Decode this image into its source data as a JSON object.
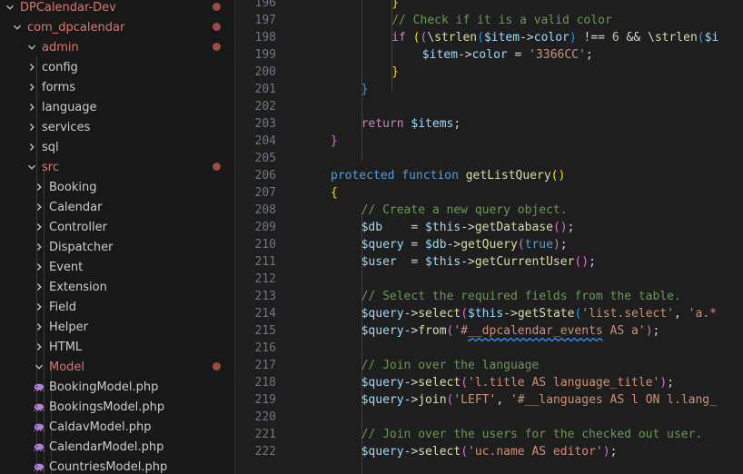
{
  "sidebar": {
    "items": [
      {
        "label": "DPCalendar-Dev",
        "depth": 0,
        "expanded": true,
        "type": "folder",
        "modified": true
      },
      {
        "label": "com_dpcalendar",
        "depth": 1,
        "expanded": true,
        "type": "folder",
        "modified": true
      },
      {
        "label": "admin",
        "depth": 2,
        "expanded": true,
        "type": "folder",
        "modified": true
      },
      {
        "label": "config",
        "depth": 3,
        "expanded": false,
        "type": "folder",
        "modified": false
      },
      {
        "label": "forms",
        "depth": 3,
        "expanded": false,
        "type": "folder",
        "modified": false
      },
      {
        "label": "language",
        "depth": 3,
        "expanded": false,
        "type": "folder",
        "modified": false
      },
      {
        "label": "services",
        "depth": 3,
        "expanded": false,
        "type": "folder",
        "modified": false
      },
      {
        "label": "sql",
        "depth": 3,
        "expanded": false,
        "type": "folder",
        "modified": false
      },
      {
        "label": "src",
        "depth": 3,
        "expanded": true,
        "type": "folder",
        "modified": true
      },
      {
        "label": "Booking",
        "depth": 4,
        "expanded": false,
        "type": "folder",
        "modified": false
      },
      {
        "label": "Calendar",
        "depth": 4,
        "expanded": false,
        "type": "folder",
        "modified": false
      },
      {
        "label": "Controller",
        "depth": 4,
        "expanded": false,
        "type": "folder",
        "modified": false
      },
      {
        "label": "Dispatcher",
        "depth": 4,
        "expanded": false,
        "type": "folder",
        "modified": false
      },
      {
        "label": "Event",
        "depth": 4,
        "expanded": false,
        "type": "folder",
        "modified": false
      },
      {
        "label": "Extension",
        "depth": 4,
        "expanded": false,
        "type": "folder",
        "modified": false
      },
      {
        "label": "Field",
        "depth": 4,
        "expanded": false,
        "type": "folder",
        "modified": false
      },
      {
        "label": "Helper",
        "depth": 4,
        "expanded": false,
        "type": "folder",
        "modified": false
      },
      {
        "label": "HTML",
        "depth": 4,
        "expanded": false,
        "type": "folder",
        "modified": false
      },
      {
        "label": "Model",
        "depth": 4,
        "expanded": true,
        "type": "folder",
        "modified": true
      },
      {
        "label": "BookingModel.php",
        "depth": 5,
        "type": "php",
        "modified": false
      },
      {
        "label": "BookingsModel.php",
        "depth": 5,
        "type": "php",
        "modified": false
      },
      {
        "label": "CaldavModel.php",
        "depth": 5,
        "type": "php",
        "modified": false
      },
      {
        "label": "CalendarModel.php",
        "depth": 5,
        "type": "php",
        "modified": false
      },
      {
        "label": "CountriesModel.php",
        "depth": 5,
        "type": "php",
        "modified": false
      }
    ]
  },
  "editor": {
    "lines": [
      {
        "n": "196",
        "tokens": [
          [
            "br1",
            "}"
          ]
        ],
        "indent": 8
      },
      {
        "n": "197",
        "tokens": [
          [
            "cmt",
            "// Check if it is a valid color"
          ]
        ],
        "indent": 8
      },
      {
        "n": "198",
        "tokens": [
          [
            "kw2",
            "if"
          ],
          [
            "op",
            " "
          ],
          [
            "br1",
            "("
          ],
          [
            "br2",
            "("
          ],
          [
            "op",
            "\\"
          ],
          [
            "fn",
            "strlen"
          ],
          [
            "br3",
            "("
          ],
          [
            "var",
            "$item"
          ],
          [
            "op",
            "->"
          ],
          [
            "var",
            "color"
          ],
          [
            "br3",
            ")"
          ],
          [
            "op",
            " !== "
          ],
          [
            "num",
            "6"
          ],
          [
            "op",
            " && \\"
          ],
          [
            "fn",
            "strlen"
          ],
          [
            "br3",
            "("
          ],
          [
            "var",
            "$i"
          ]
        ],
        "indent": 8
      },
      {
        "n": "199",
        "tokens": [
          [
            "var",
            "$item"
          ],
          [
            "op",
            "->"
          ],
          [
            "var",
            "color"
          ],
          [
            "op",
            " = "
          ],
          [
            "str",
            "'3366CC'"
          ],
          [
            "op",
            ";"
          ]
        ],
        "indent": 12
      },
      {
        "n": "200",
        "tokens": [
          [
            "br1",
            "}"
          ]
        ],
        "indent": 8
      },
      {
        "n": "201",
        "tokens": [
          [
            "br3",
            "}"
          ]
        ],
        "indent": 4
      },
      {
        "n": "202",
        "tokens": [],
        "indent": 0
      },
      {
        "n": "203",
        "tokens": [
          [
            "kw2",
            "return"
          ],
          [
            "op",
            " "
          ],
          [
            "var",
            "$items"
          ],
          [
            "op",
            ";"
          ]
        ],
        "indent": 4
      },
      {
        "n": "204",
        "tokens": [
          [
            "br2",
            "}"
          ]
        ],
        "indent": 0
      },
      {
        "n": "205",
        "tokens": [],
        "indent": 0
      },
      {
        "n": "206",
        "tokens": [
          [
            "kw",
            "protected"
          ],
          [
            "op",
            " "
          ],
          [
            "kw",
            "function"
          ],
          [
            "op",
            " "
          ],
          [
            "fn",
            "getListQuery"
          ],
          [
            "br1",
            "()"
          ]
        ],
        "indent": 0
      },
      {
        "n": "207",
        "tokens": [
          [
            "br1",
            "{"
          ]
        ],
        "indent": 0
      },
      {
        "n": "208",
        "tokens": [
          [
            "cmt",
            "// Create a new query object."
          ]
        ],
        "indent": 4
      },
      {
        "n": "209",
        "tokens": [
          [
            "var",
            "$db"
          ],
          [
            "op",
            "    = "
          ],
          [
            "var",
            "$this"
          ],
          [
            "op",
            "->"
          ],
          [
            "fn",
            "getDatabase"
          ],
          [
            "br2",
            "()"
          ],
          [
            "op",
            ";"
          ]
        ],
        "indent": 4
      },
      {
        "n": "210",
        "tokens": [
          [
            "var",
            "$query"
          ],
          [
            "op",
            " = "
          ],
          [
            "var",
            "$db"
          ],
          [
            "op",
            "->"
          ],
          [
            "fn",
            "getQuery"
          ],
          [
            "br2",
            "("
          ],
          [
            "kw",
            "true"
          ],
          [
            "br2",
            ")"
          ],
          [
            "op",
            ";"
          ]
        ],
        "indent": 4
      },
      {
        "n": "211",
        "tokens": [
          [
            "var",
            "$user"
          ],
          [
            "op",
            "  = "
          ],
          [
            "var",
            "$this"
          ],
          [
            "op",
            "->"
          ],
          [
            "fn",
            "getCurrentUser"
          ],
          [
            "br2",
            "()"
          ],
          [
            "op",
            ";"
          ]
        ],
        "indent": 4
      },
      {
        "n": "212",
        "tokens": [],
        "indent": 0
      },
      {
        "n": "213",
        "tokens": [
          [
            "cmt",
            "// Select the required fields from the table."
          ]
        ],
        "indent": 4
      },
      {
        "n": "214",
        "tokens": [
          [
            "var",
            "$query"
          ],
          [
            "op",
            "->"
          ],
          [
            "fn",
            "select"
          ],
          [
            "br2",
            "("
          ],
          [
            "var",
            "$this"
          ],
          [
            "op",
            "->"
          ],
          [
            "fn",
            "getState"
          ],
          [
            "br3",
            "("
          ],
          [
            "str",
            "'list.select'"
          ],
          [
            "op",
            ", "
          ],
          [
            "str",
            "'a.*"
          ]
        ],
        "indent": 4
      },
      {
        "n": "215",
        "tokens": [
          [
            "var",
            "$query"
          ],
          [
            "op",
            "->"
          ],
          [
            "fn",
            "from"
          ],
          [
            "br2",
            "("
          ],
          [
            "str",
            "'#"
          ],
          [
            "sq",
            "__dpcalendar_events"
          ],
          [
            "str",
            " AS a'"
          ],
          [
            "br2",
            ")"
          ],
          [
            "op",
            ";"
          ]
        ],
        "indent": 4
      },
      {
        "n": "216",
        "tokens": [],
        "indent": 0
      },
      {
        "n": "217",
        "tokens": [
          [
            "cmt",
            "// Join over the language"
          ]
        ],
        "indent": 4
      },
      {
        "n": "218",
        "tokens": [
          [
            "var",
            "$query"
          ],
          [
            "op",
            "->"
          ],
          [
            "fn",
            "select"
          ],
          [
            "br2",
            "("
          ],
          [
            "str",
            "'l.title AS language_title'"
          ],
          [
            "br2",
            ")"
          ],
          [
            "op",
            ";"
          ]
        ],
        "indent": 4
      },
      {
        "n": "219",
        "tokens": [
          [
            "var",
            "$query"
          ],
          [
            "op",
            "->"
          ],
          [
            "fn",
            "join"
          ],
          [
            "br2",
            "("
          ],
          [
            "str",
            "'LEFT'"
          ],
          [
            "op",
            ", "
          ],
          [
            "str",
            "'#__languages AS l ON l.lang_"
          ]
        ],
        "indent": 4
      },
      {
        "n": "220",
        "tokens": [],
        "indent": 0
      },
      {
        "n": "221",
        "tokens": [
          [
            "cmt",
            "// Join over the users for the checked out user."
          ]
        ],
        "indent": 4
      },
      {
        "n": "222",
        "tokens": [
          [
            "var",
            "$query"
          ],
          [
            "op",
            "->"
          ],
          [
            "fn",
            "select"
          ],
          [
            "br2",
            "("
          ],
          [
            "str",
            "'uc.name AS editor'"
          ],
          [
            "br2",
            ")"
          ],
          [
            "op",
            ";"
          ]
        ],
        "indent": 4
      }
    ]
  }
}
